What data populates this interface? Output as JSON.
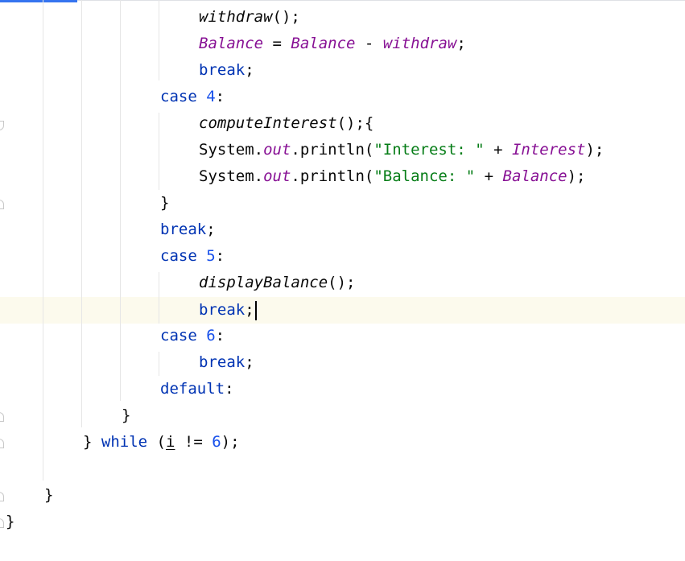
{
  "editor": {
    "accent_color": "#3574f0",
    "current_line_color": "#fcfaed",
    "lines": [
      {
        "withdraw_call": "withdraw",
        "parens": "();"
      },
      {
        "lhs": "Balance",
        "eq": " = ",
        "rhs": "Balance",
        "minus": " - ",
        "operand": "withdraw",
        "semi": ";"
      },
      {
        "kw": "break",
        "semi": ";"
      },
      {
        "kw": "case",
        "num": "4",
        "colon": ":"
      },
      {
        "method": "computeInterest",
        "rest": "();{"
      },
      {
        "prefix": "System.",
        "field": "out",
        "call": ".println(",
        "str": "\"Interest: \"",
        "plus": " + ",
        "var": "Interest",
        "end": ");"
      },
      {
        "prefix": "System.",
        "field": "out",
        "call": ".println(",
        "str": "\"Balance: \"",
        "plus": " + ",
        "var": "Balance",
        "end": ");"
      },
      {
        "brace": "}"
      },
      {
        "kw": "break",
        "semi": ";"
      },
      {
        "kw": "case",
        "num": "5",
        "colon": ":"
      },
      {
        "method": "displayBalance",
        "rest": "();"
      },
      {
        "kw": "break",
        "semi": ";"
      },
      {
        "kw": "case",
        "num": "6",
        "colon": ":"
      },
      {
        "kw": "break",
        "semi": ";"
      },
      {
        "kw": "default",
        "colon": ":"
      },
      {
        "brace": "}"
      },
      {
        "brace": "}",
        "kw": "while",
        "open": " (",
        "var": "i",
        "op": " != ",
        "num": "6",
        "end": ");"
      },
      {
        "brace": "}"
      },
      {
        "brace": "}"
      }
    ]
  }
}
